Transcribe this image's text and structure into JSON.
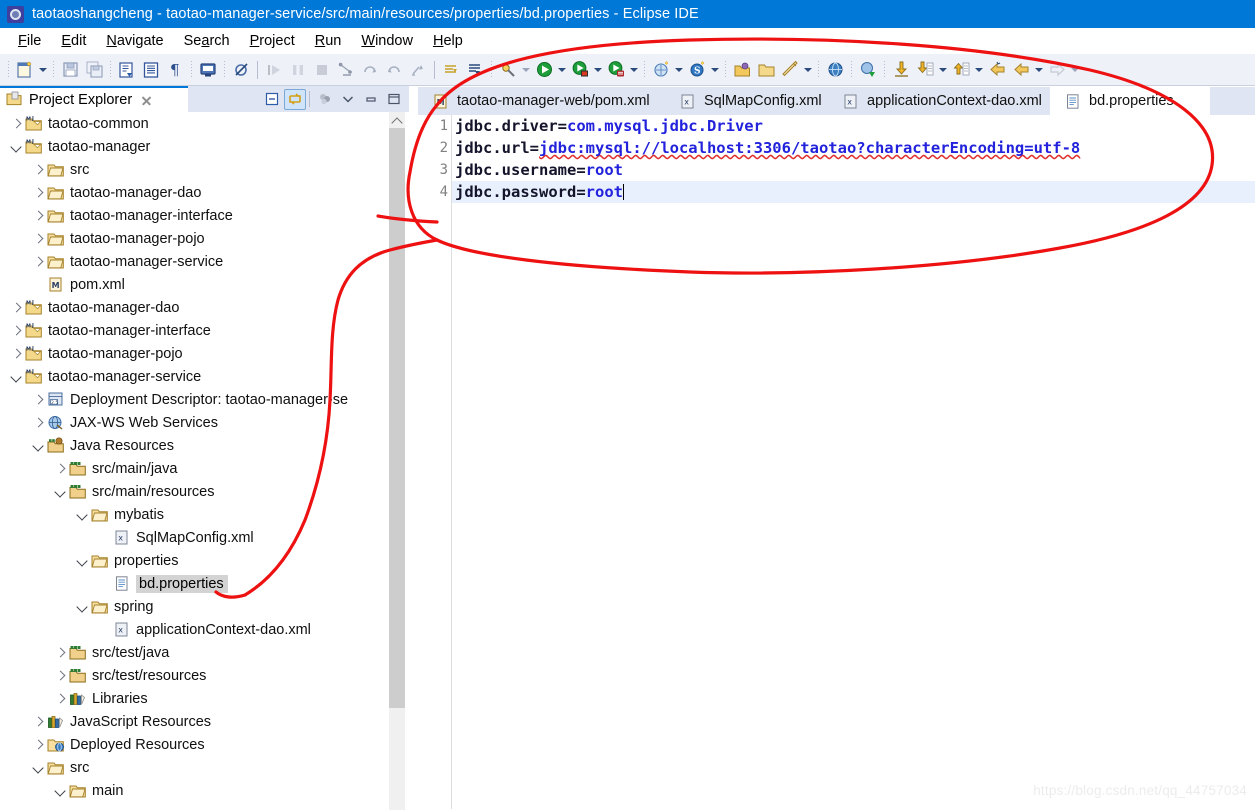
{
  "window": {
    "title": "taotaoshangcheng - taotao-manager-service/src/main/resources/properties/bd.properties - Eclipse IDE",
    "app_icon": "eclipse-icon"
  },
  "menubar": {
    "items": [
      {
        "label": "File",
        "mnemonic": "F"
      },
      {
        "label": "Edit",
        "mnemonic": "E"
      },
      {
        "label": "Navigate",
        "mnemonic": "N"
      },
      {
        "label": "Search",
        "mnemonic": "a"
      },
      {
        "label": "Project",
        "mnemonic": "P"
      },
      {
        "label": "Run",
        "mnemonic": "R"
      },
      {
        "label": "Window",
        "mnemonic": "W"
      },
      {
        "label": "Help",
        "mnemonic": "H"
      }
    ]
  },
  "toolbar": {
    "buttons": [
      "new-wizard-icon",
      "new-dropdown-caret",
      "save-icon",
      "save-all-icon",
      "build-icon",
      "toggle-block-selection-icon",
      "show-whitespace-icon",
      "open-console-icon",
      "skip-all-breakpoints-icon",
      "resume-icon",
      "suspend-icon",
      "terminate-icon",
      "step-into-icon",
      "step-over-icon",
      "step-return-icon",
      "drop-to-frame-icon",
      "next-annotation-icon",
      "previous-annotation-icon",
      "debug-icon",
      "debug-caret",
      "run-icon",
      "run-caret",
      "run-as-server-icon",
      "run-as-server-caret",
      "coverage-icon",
      "coverage-caret",
      "new-java-project-icon",
      "new-java-caret",
      "new-spring-icon",
      "new-spring-caret",
      "open-type-icon",
      "open-resource-icon",
      "search-icon",
      "search-caret",
      "open-web-browser-icon",
      "open-perspective-icon",
      "import-icon",
      "import-caret",
      "export-icon",
      "export-caret",
      "back-icon",
      "forward-back-icon",
      "back-caret",
      "forward-icon",
      "forward-caret"
    ]
  },
  "project_explorer": {
    "tab_label": "Project Explorer",
    "tab_icon": "project-explorer-icon",
    "close_icon": "close-icon",
    "view_buttons": [
      {
        "name": "collapse-all-button",
        "icon": "collapse-all-icon",
        "active": false
      },
      {
        "name": "link-with-editor-button",
        "icon": "link-with-editor-icon",
        "active": true
      },
      {
        "name": "view-menu-filters-button",
        "icon": "filters-icon",
        "active": false
      },
      {
        "name": "view-menu-button",
        "icon": "chevron-down-icon",
        "active": false
      },
      {
        "name": "minimize-button",
        "icon": "minimize-icon",
        "active": false
      },
      {
        "name": "maximize-button",
        "icon": "maximize-icon",
        "active": false
      }
    ],
    "tree": [
      {
        "label": "taotao-common",
        "indent": 0,
        "twist": "collapsed",
        "icon": "maven-project-icon"
      },
      {
        "label": "taotao-manager",
        "indent": 0,
        "twist": "expanded",
        "icon": "maven-project-icon"
      },
      {
        "label": "src",
        "indent": 1,
        "twist": "collapsed",
        "icon": "folder-icon"
      },
      {
        "label": "taotao-manager-dao",
        "indent": 1,
        "twist": "collapsed",
        "icon": "folder-icon"
      },
      {
        "label": "taotao-manager-interface",
        "indent": 1,
        "twist": "collapsed",
        "icon": "folder-icon"
      },
      {
        "label": "taotao-manager-pojo",
        "indent": 1,
        "twist": "collapsed",
        "icon": "folder-icon"
      },
      {
        "label": "taotao-manager-service",
        "indent": 1,
        "twist": "collapsed",
        "icon": "folder-icon"
      },
      {
        "label": "pom.xml",
        "indent": 1,
        "twist": "none",
        "icon": "pom-xml-icon"
      },
      {
        "label": "taotao-manager-dao",
        "indent": 0,
        "twist": "collapsed",
        "icon": "maven-project-icon"
      },
      {
        "label": "taotao-manager-interface",
        "indent": 0,
        "twist": "collapsed",
        "icon": "maven-project-icon"
      },
      {
        "label": "taotao-manager-pojo",
        "indent": 0,
        "twist": "collapsed",
        "icon": "maven-project-icon"
      },
      {
        "label": "taotao-manager-service",
        "indent": 0,
        "twist": "expanded",
        "icon": "maven-project-icon"
      },
      {
        "label": "Deployment Descriptor: taotao-manager-se",
        "indent": 1,
        "twist": "collapsed",
        "icon": "deployment-descriptor-icon"
      },
      {
        "label": "JAX-WS Web Services",
        "indent": 1,
        "twist": "collapsed",
        "icon": "jaxws-icon"
      },
      {
        "label": "Java Resources",
        "indent": 1,
        "twist": "expanded",
        "icon": "java-resources-icon"
      },
      {
        "label": "src/main/java",
        "indent": 2,
        "twist": "collapsed",
        "icon": "source-folder-icon"
      },
      {
        "label": "src/main/resources",
        "indent": 2,
        "twist": "expanded",
        "icon": "source-folder-icon"
      },
      {
        "label": "mybatis",
        "indent": 3,
        "twist": "expanded",
        "icon": "folder-icon"
      },
      {
        "label": "SqlMapConfig.xml",
        "indent": 4,
        "twist": "none",
        "icon": "xml-file-icon"
      },
      {
        "label": "properties",
        "indent": 3,
        "twist": "expanded",
        "icon": "folder-icon"
      },
      {
        "label": "bd.properties",
        "indent": 4,
        "twist": "none",
        "icon": "properties-file-icon",
        "selected": true
      },
      {
        "label": "spring",
        "indent": 3,
        "twist": "expanded",
        "icon": "folder-icon"
      },
      {
        "label": "applicationContext-dao.xml",
        "indent": 4,
        "twist": "none",
        "icon": "xml-file-icon"
      },
      {
        "label": "src/test/java",
        "indent": 2,
        "twist": "collapsed",
        "icon": "source-folder-icon"
      },
      {
        "label": "src/test/resources",
        "indent": 2,
        "twist": "collapsed",
        "icon": "source-folder-icon"
      },
      {
        "label": "Libraries",
        "indent": 2,
        "twist": "collapsed",
        "icon": "libraries-icon"
      },
      {
        "label": "JavaScript Resources",
        "indent": 1,
        "twist": "collapsed",
        "icon": "libraries-icon"
      },
      {
        "label": "Deployed Resources",
        "indent": 1,
        "twist": "collapsed",
        "icon": "deployed-resources-icon"
      },
      {
        "label": "src",
        "indent": 1,
        "twist": "expanded",
        "icon": "folder-icon"
      },
      {
        "label": "main",
        "indent": 2,
        "twist": "expanded",
        "icon": "folder-icon"
      }
    ]
  },
  "editor": {
    "tabs": [
      {
        "label": "taotao-manager-web/pom.xml",
        "icon": "pom-xml-icon",
        "active": false
      },
      {
        "label": "SqlMapConfig.xml",
        "icon": "xml-file-icon",
        "active": false
      },
      {
        "label": "applicationContext-dao.xml",
        "icon": "xml-file-icon",
        "active": false
      },
      {
        "label": "bd.properties",
        "icon": "properties-file-icon",
        "active": true
      }
    ],
    "line_numbers": [
      "1",
      "2",
      "3",
      "4"
    ],
    "lines": [
      {
        "key": "jdbc.driver=",
        "value": "com.mysql.jdbc.Driver",
        "current": false
      },
      {
        "key": "jdbc.url=",
        "value": "jdbc:mysql://localhost:3306/taotao?characterEncoding=utf-8",
        "current": false,
        "spellcheck": true
      },
      {
        "key": "jdbc.username=",
        "value": "root",
        "current": false
      },
      {
        "key": "jdbc.password=",
        "value": "root",
        "current": true,
        "caret": true
      }
    ],
    "colors": {
      "key": "#14142b",
      "value": "#2222dd",
      "current_line": "#e8f0fe",
      "spell_underline": "#e03030"
    }
  },
  "annotation": {
    "color": "#ee1111",
    "shape": "hand-drawn-ellipse-with-pointer-tail",
    "target": "bd.properties"
  },
  "watermark": {
    "text": "https://blog.csdn.net/qq_44757034"
  }
}
